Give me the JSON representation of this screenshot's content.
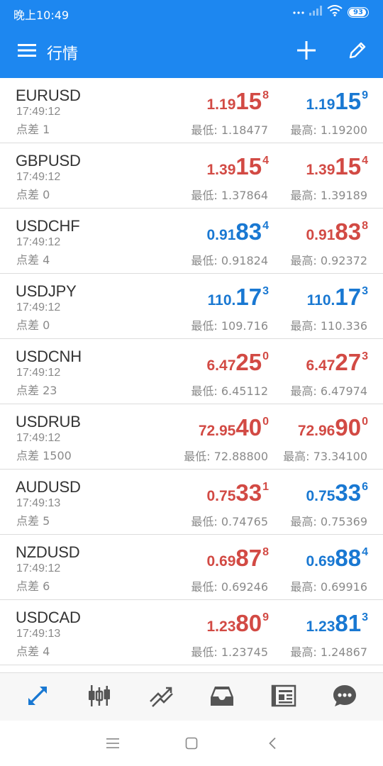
{
  "status_bar": {
    "time": "晚上10:49",
    "battery": "93",
    "battery_level": 0.93
  },
  "app_bar": {
    "title": "行情",
    "menu_icon": "menu-icon",
    "add_icon": "add-icon",
    "edit_icon": "edit-icon"
  },
  "labels": {
    "spread": "点差",
    "low": "最低:",
    "high": "最高:"
  },
  "colors": {
    "header": "#1d87f0",
    "up": "#1978d2",
    "down": "#d24a44"
  },
  "quotes": [
    {
      "symbol": "EURUSD",
      "time": "17:49:12",
      "spread": "1",
      "bid": {
        "small": "1.19",
        "big": "15",
        "sup": "8",
        "dir": "down"
      },
      "ask": {
        "small": "1.19",
        "big": "15",
        "sup": "9",
        "dir": "up"
      },
      "low": "1.18477",
      "high": "1.19200"
    },
    {
      "symbol": "GBPUSD",
      "time": "17:49:12",
      "spread": "0",
      "bid": {
        "small": "1.39",
        "big": "15",
        "sup": "4",
        "dir": "down"
      },
      "ask": {
        "small": "1.39",
        "big": "15",
        "sup": "4",
        "dir": "down"
      },
      "low": "1.37864",
      "high": "1.39189"
    },
    {
      "symbol": "USDCHF",
      "time": "17:49:12",
      "spread": "4",
      "bid": {
        "small": "0.91",
        "big": "83",
        "sup": "4",
        "dir": "up"
      },
      "ask": {
        "small": "0.91",
        "big": "83",
        "sup": "8",
        "dir": "down"
      },
      "low": "0.91824",
      "high": "0.92372"
    },
    {
      "symbol": "USDJPY",
      "time": "17:49:12",
      "spread": "0",
      "bid": {
        "small": "110.",
        "big": "17",
        "sup": "3",
        "dir": "up"
      },
      "ask": {
        "small": "110.",
        "big": "17",
        "sup": "3",
        "dir": "up"
      },
      "low": "109.716",
      "high": "110.336"
    },
    {
      "symbol": "USDCNH",
      "time": "17:49:12",
      "spread": "23",
      "bid": {
        "small": "6.47",
        "big": "25",
        "sup": "0",
        "dir": "down"
      },
      "ask": {
        "small": "6.47",
        "big": "27",
        "sup": "3",
        "dir": "down"
      },
      "low": "6.45112",
      "high": "6.47974"
    },
    {
      "symbol": "USDRUB",
      "time": "17:49:12",
      "spread": "1500",
      "bid": {
        "small": "72.95",
        "big": "40",
        "sup": "0",
        "dir": "down"
      },
      "ask": {
        "small": "72.96",
        "big": "90",
        "sup": "0",
        "dir": "down"
      },
      "low": "72.88800",
      "high": "73.34100"
    },
    {
      "symbol": "AUDUSD",
      "time": "17:49:13",
      "spread": "5",
      "bid": {
        "small": "0.75",
        "big": "33",
        "sup": "1",
        "dir": "down"
      },
      "ask": {
        "small": "0.75",
        "big": "33",
        "sup": "6",
        "dir": "up"
      },
      "low": "0.74765",
      "high": "0.75369"
    },
    {
      "symbol": "NZDUSD",
      "time": "17:49:12",
      "spread": "6",
      "bid": {
        "small": "0.69",
        "big": "87",
        "sup": "8",
        "dir": "down"
      },
      "ask": {
        "small": "0.69",
        "big": "88",
        "sup": "4",
        "dir": "up"
      },
      "low": "0.69246",
      "high": "0.69916"
    },
    {
      "symbol": "USDCAD",
      "time": "17:49:13",
      "spread": "4",
      "bid": {
        "small": "1.23",
        "big": "80",
        "sup": "9",
        "dir": "down"
      },
      "ask": {
        "small": "1.23",
        "big": "81",
        "sup": "3",
        "dir": "up"
      },
      "low": "1.23745",
      "high": "1.24867"
    }
  ],
  "tabs": [
    {
      "name": "tab-quotes",
      "icon": "quotes-arrows-icon",
      "active": true
    },
    {
      "name": "tab-chart",
      "icon": "candlestick-icon",
      "active": false
    },
    {
      "name": "tab-trade",
      "icon": "trade-lines-icon",
      "active": false
    },
    {
      "name": "tab-history",
      "icon": "inbox-icon",
      "active": false
    },
    {
      "name": "tab-news",
      "icon": "newspaper-icon",
      "active": false
    },
    {
      "name": "tab-messages",
      "icon": "chat-icon",
      "active": false
    }
  ],
  "system_nav": [
    "menu-icon",
    "home-icon",
    "back-icon"
  ]
}
